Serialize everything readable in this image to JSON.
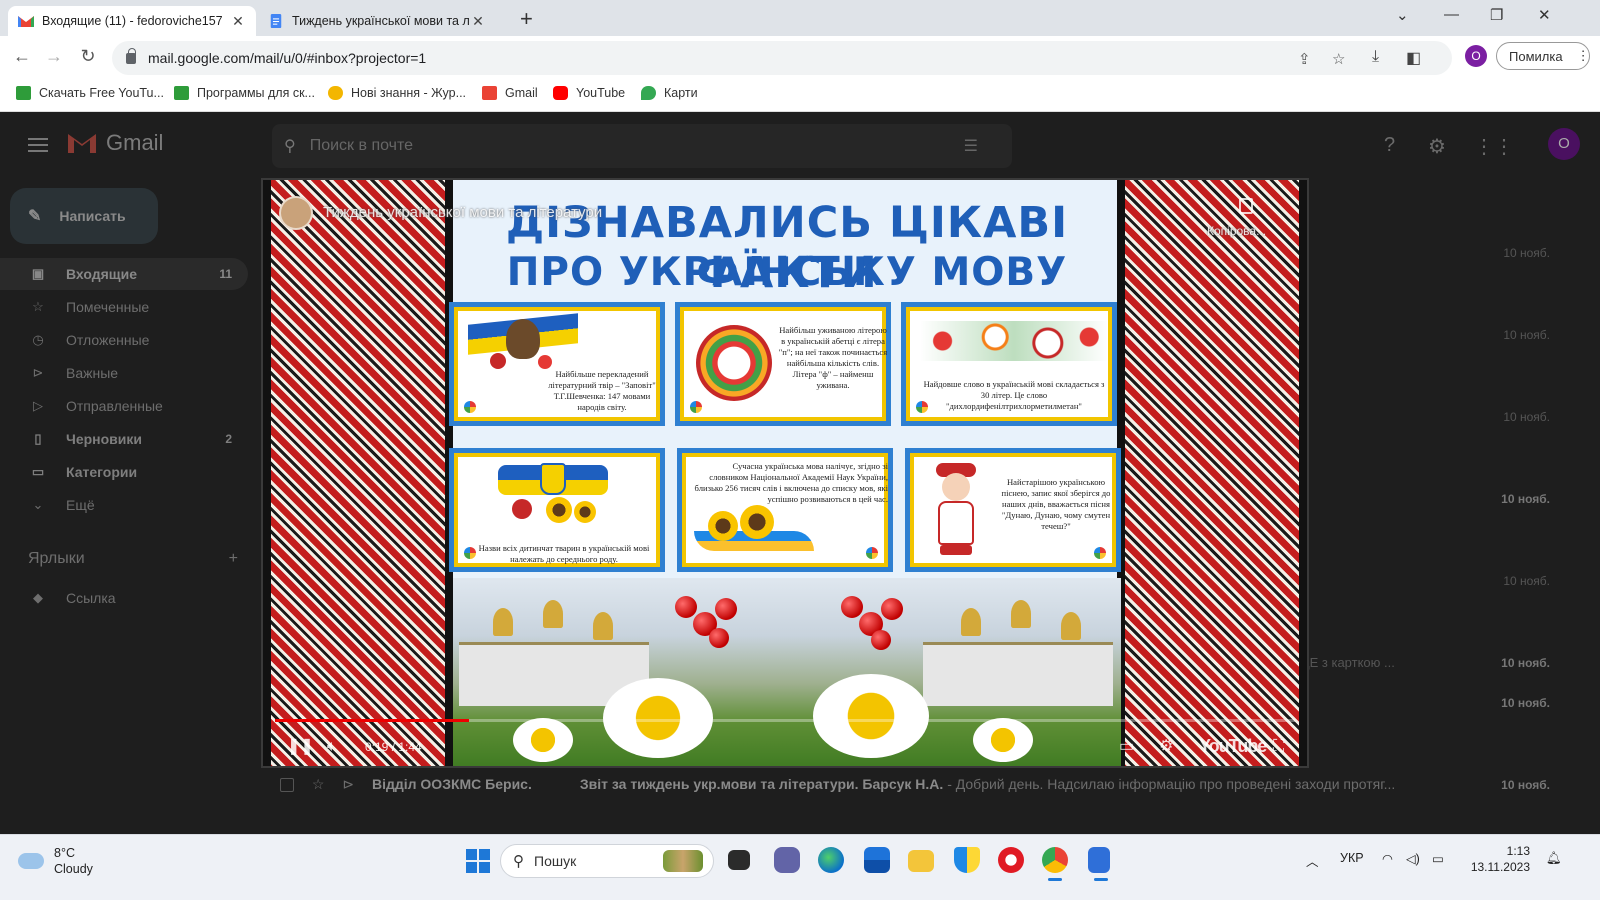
{
  "browser": {
    "tabs": [
      {
        "title": "Входящие (11) - fedoroviche157",
        "icon": "gmail-icon",
        "active": true
      },
      {
        "title": "Тиждень української мови та л",
        "icon": "docs-icon",
        "active": false
      }
    ],
    "url": "mail.google.com/mail/u/0/#inbox?projector=1",
    "profile_initial": "O",
    "error_label": "Помилка",
    "bookmarks": [
      {
        "label": "Скачать Free YouTu...",
        "color": "#2e9c3a"
      },
      {
        "label": "Программы для ск...",
        "color": "#2e9c3a"
      },
      {
        "label": "Нові знання - Жур...",
        "color": "#f3b600"
      },
      {
        "label": "Gmail",
        "color": "#ea4335"
      },
      {
        "label": "YouTube",
        "color": "#ff0000"
      },
      {
        "label": "Карти",
        "color": "#34a853"
      }
    ]
  },
  "gmail": {
    "logo_text": "Gmail",
    "search_placeholder": "Поиск в почте",
    "avatar_initial": "O",
    "compose_label": "Написать",
    "nav": [
      {
        "label": "Входящие",
        "count": "11",
        "icon": "inbox-icon",
        "selected": true,
        "bold": true
      },
      {
        "label": "Помеченные",
        "count": "",
        "icon": "star-icon",
        "selected": false,
        "bold": false
      },
      {
        "label": "Отложенные",
        "count": "",
        "icon": "clock-icon",
        "selected": false,
        "bold": false
      },
      {
        "label": "Важные",
        "count": "",
        "icon": "important-icon",
        "selected": false,
        "bold": false
      },
      {
        "label": "Отправленные",
        "count": "",
        "icon": "send-icon",
        "selected": false,
        "bold": false
      },
      {
        "label": "Черновики",
        "count": "2",
        "icon": "draft-icon",
        "selected": false,
        "bold": true
      },
      {
        "label": "Категории",
        "count": "",
        "icon": "label-icon",
        "selected": false,
        "bold": true
      },
      {
        "label": "Ещё",
        "count": "",
        "icon": "chevron-down-icon",
        "selected": false,
        "bold": false
      }
    ],
    "labels_header": "Ярлыки",
    "labels": [
      {
        "label": "Ссылка",
        "icon": "label-icon"
      }
    ],
    "row_dates": [
      {
        "text": "10 нояб.",
        "bold": false
      },
      {
        "text": "10 нояб.",
        "bold": false
      },
      {
        "text": "10 нояб.",
        "bold": false
      },
      {
        "text": "10 нояб.",
        "bold": true
      },
      {
        "text": "10 нояб.",
        "bold": false
      },
      {
        "text": "10 нояб.",
        "bold": true
      },
      {
        "text": "10 нояб.",
        "bold": true
      },
      {
        "text": "10 нояб.",
        "bold": true
      }
    ],
    "partial_snippet": "ЦЕ з карткою ...",
    "last_row": {
      "sender": "Відділ ООЗКМС Берис.",
      "subject": "Звіт за тиждень укр.мови та літератури. Барсук Н.А.",
      "snippet": " - Добрий день. Надсилаю інформацію про проведені заходи протяг..."
    }
  },
  "viewer": {
    "overlay_title": "Тиждень української мови та літератури",
    "copy_label": "Копірова...",
    "slide_title_line1": "ДІЗНАВАЛИСЬ ЦІКАВІ ФАКТИ",
    "slide_title_line2": "ПРО УКРАЇНСЬКУ МОВУ",
    "cards": [
      {
        "text": "Найбільше перекладений літературний твір – \"Заповіт\" Т.Г.Шевченка: 147 мовами народів світу."
      },
      {
        "text": "Найбільш уживаною літерою в українській абетці є літера \"п\"; на неї також починається найбільша кількість слів. Літера \"ф\" – найменш уживана."
      },
      {
        "text": "Найдовше слово в українській мові складається з 30 літер. Це слово \"дихлордифенілтрихлорметилметан\""
      },
      {
        "text": "Назви всіх дитинчат тварин в українській мові належать до середнього роду."
      },
      {
        "text": "Сучасна українська мова налічує, згідно зі словником Національної Академії Наук України, близько 256 тисяч слів і включена до списку мов, які успішно розвиваються в цей час."
      },
      {
        "text": "Найстарішою українською піснею, запис якої зберігся до наших днів, вважається пісня \"Дунаю, Дунаю, чому смутен течеш?\""
      }
    ],
    "player_time": "0:19 / 1:44",
    "progress_fraction": 0.19,
    "player_brand": "YouTube"
  },
  "taskbar": {
    "temperature": "8°C",
    "condition": "Cloudy",
    "search_label": "Пошук",
    "language": "УКР",
    "time": "1:13",
    "date": "13.11.2023"
  }
}
